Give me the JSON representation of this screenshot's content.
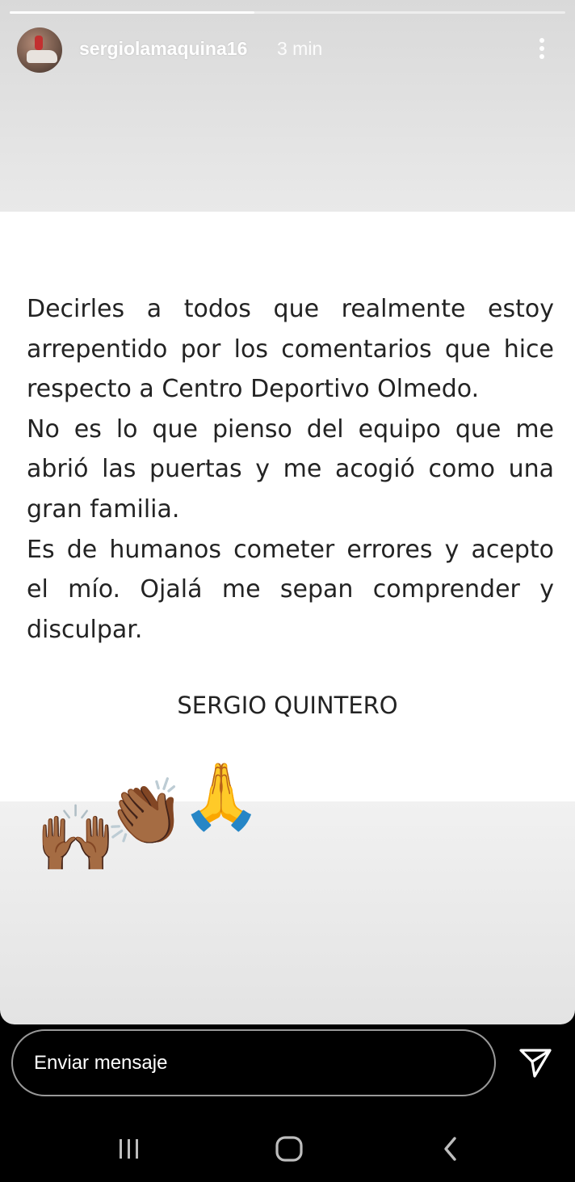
{
  "story": {
    "username": "sergiolamaquina16",
    "time": "3 min",
    "progress": 0.44
  },
  "letter": {
    "paragraphs": [
      "Decirles a todos que realmente estoy arrepentido por los comentarios que hice respecto a Centro Deportivo Olmedo.",
      "No es lo que pienso del equipo que me abrió las puertas y me acogió como una gran familia.",
      "Es de humanos cometer errores y acepto el mío. Ojalá me sepan comprender y disculpar."
    ],
    "signature": "SERGIO QUINTERO"
  },
  "stickers": {
    "raising_hands": "🙌🏾",
    "clapping_hands": "👏🏾",
    "folded_hands": "🙏"
  },
  "reply": {
    "placeholder": "Enviar mensaje"
  },
  "icons": {
    "more": "more-vertical-icon",
    "send": "paper-plane-icon",
    "recents": "recents-icon",
    "home": "home-icon",
    "back": "back-icon"
  }
}
